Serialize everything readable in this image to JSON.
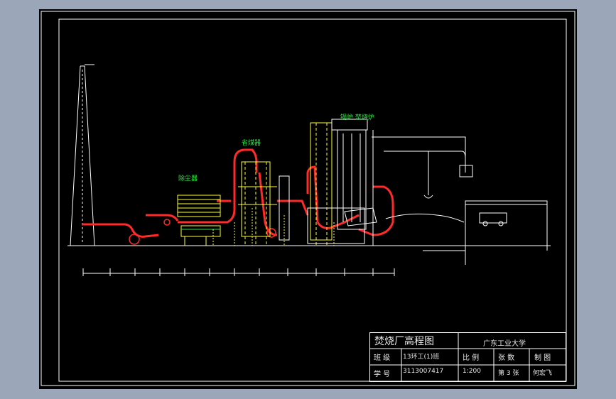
{
  "labels": {
    "dust_collector": "除尘器",
    "economizer": "省煤器",
    "boiler_furnace": "锅炉  焚烧炉"
  },
  "title_block": {
    "title": "焚烧厂高程图",
    "school": "广东工业大学",
    "class_label": "班  级",
    "class_value": "13环工(1)班",
    "ratio_label": "比  例",
    "sheets_label": "张  数",
    "drawn_label": "制  图",
    "id_label": "学  号",
    "id_value": "3113007417",
    "ratio_value": "1:200",
    "sheet_value": "第 3 张",
    "drawer_value": "何宏飞"
  },
  "colors": {
    "background": "#000000",
    "frame": "#ffffff",
    "duct": "#ff2a2a",
    "structure": "#ffff33",
    "label": "#35e04a"
  }
}
